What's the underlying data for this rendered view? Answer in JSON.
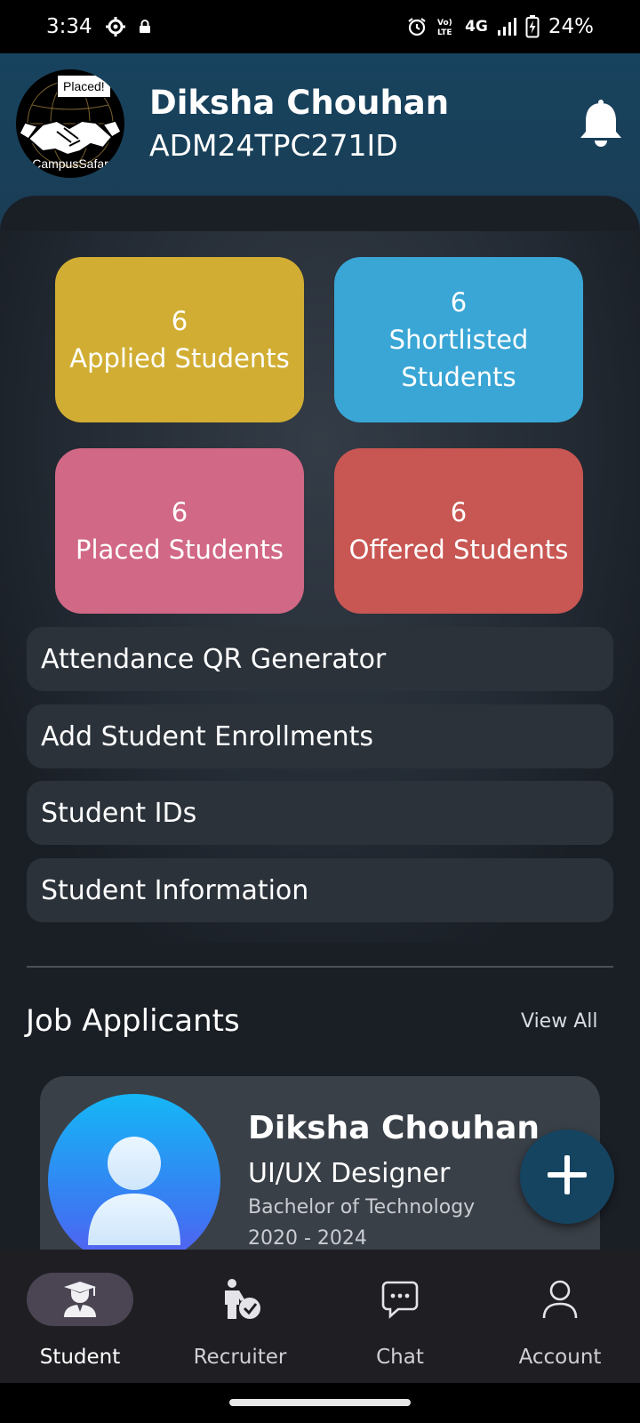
{
  "status_bar": {
    "time": "3:34",
    "network": "4G",
    "volte": "Vo)) LTE",
    "battery": "24%",
    "icons": [
      "settings-icon",
      "lock-icon",
      "alarm-icon",
      "volte-icon",
      "signal-icon",
      "battery-charging-icon"
    ]
  },
  "header": {
    "logo_badge": "Placed!",
    "logo_text": "CampusSafar",
    "name": "Diksha Chouhan",
    "id": "ADM24TPC271ID",
    "bell_icon": "bell-icon"
  },
  "stats": [
    {
      "count": "6",
      "label": "Applied Students",
      "color": "#d1ae33"
    },
    {
      "count": "6",
      "label": "Shortlisted Students",
      "color": "#3aa6d5"
    },
    {
      "count": "6",
      "label": "Placed Students",
      "color": "#d16885"
    },
    {
      "count": "6",
      "label": "Offered Students",
      "color": "#c85652"
    }
  ],
  "menu": [
    {
      "label": "Attendance QR Generator"
    },
    {
      "label": "Add Student Enrollments"
    },
    {
      "label": "Student IDs"
    },
    {
      "label": "Student Information"
    }
  ],
  "job_applicants": {
    "title": "Job Applicants",
    "view_all": "View All",
    "items": [
      {
        "name": "Diksha Chouhan",
        "role": "UI/UX Designer",
        "degree": "Bachelor of Technology",
        "years": "2020 - 2024"
      }
    ]
  },
  "fab_icon": "plus-icon",
  "bottom_nav": {
    "active": "Student",
    "items": [
      {
        "label": "Student",
        "icon": "graduate-icon"
      },
      {
        "label": "Recruiter",
        "icon": "recruiter-icon"
      },
      {
        "label": "Chat",
        "icon": "chat-icon"
      },
      {
        "label": "Account",
        "icon": "account-icon"
      }
    ]
  }
}
